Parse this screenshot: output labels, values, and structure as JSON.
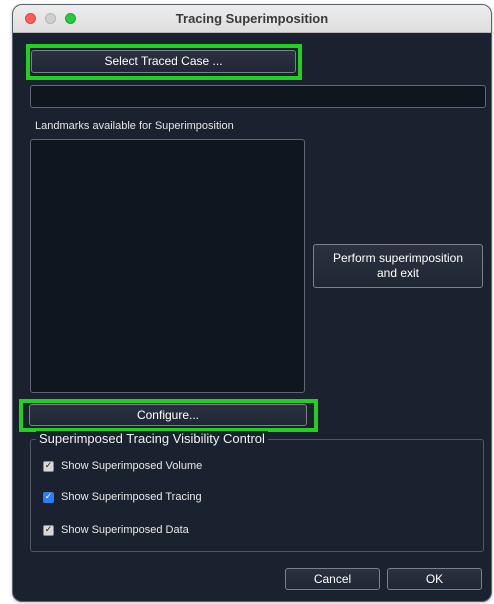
{
  "window": {
    "title": "Tracing Superimposition"
  },
  "buttons": {
    "select_traced_case": "Select Traced Case ...",
    "perform_line1": "Perform superimposition",
    "perform_line2": "and exit",
    "configure": "Configure...",
    "cancel": "Cancel",
    "ok": "OK"
  },
  "case_path": {
    "value": ""
  },
  "landmarks": {
    "label": "Landmarks available for Superimposition",
    "items": []
  },
  "visibility": {
    "title": "Superimposed Tracing Visibility Control",
    "items": [
      {
        "label": "Show Superimposed Volume",
        "checked": true,
        "check_style": "gray"
      },
      {
        "label": "Show Superimposed Tracing",
        "checked": true,
        "check_style": "blue"
      },
      {
        "label": "Show Superimposed Data",
        "checked": true,
        "check_style": "gray"
      }
    ]
  },
  "highlight_color": "#22d11f"
}
